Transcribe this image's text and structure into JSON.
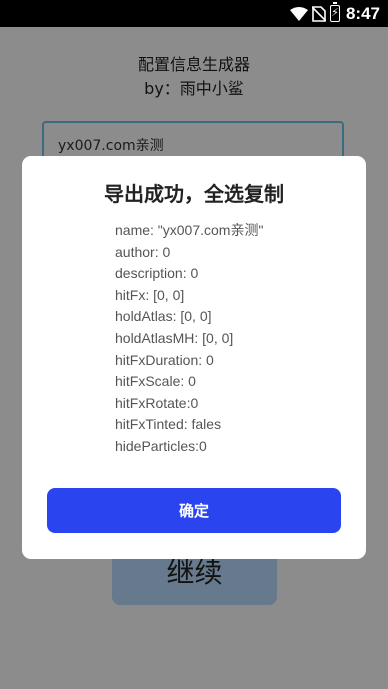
{
  "status_bar": {
    "time": "8:47",
    "icons": [
      "wifi-icon",
      "no-sim-icon",
      "battery-charging-icon"
    ]
  },
  "app": {
    "title": "配置信息生成器",
    "subtitle": "by：雨中小鲨",
    "input_value": "yx007.com亲测",
    "continue_label": "继续"
  },
  "dialog": {
    "title": "导出成功，全选复制",
    "lines": [
      "name: \"yx007.com亲测\"",
      "author: 0",
      "description: 0",
      "hitFx: [0, 0]",
      "holdAtlas: [0, 0]",
      "holdAtlasMH: [0, 0]",
      "hitFxDuration: 0",
      "hitFxScale: 0",
      "hitFxRotate:0",
      "hitFxTinted: fales",
      "hideParticles:0"
    ],
    "confirm_label": "确定"
  },
  "colors": {
    "accent": "#2a45f0",
    "input_border": "#6ec1e8",
    "continue_bg": "#bcdcff"
  }
}
